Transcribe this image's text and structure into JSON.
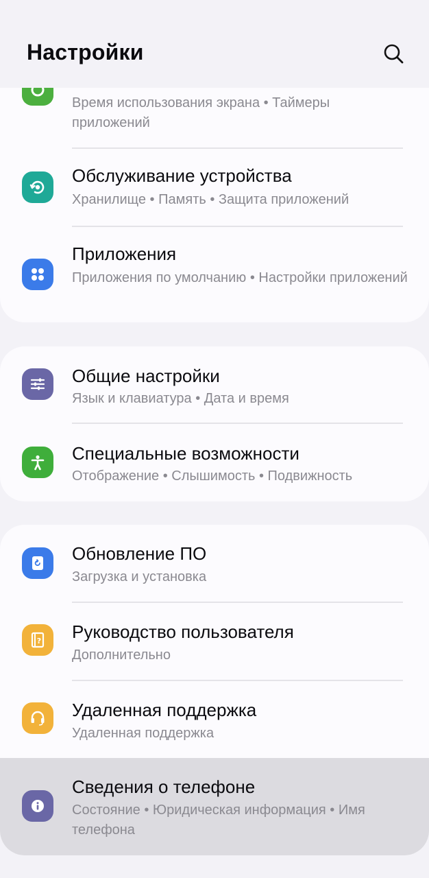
{
  "header": {
    "title": "Настройки",
    "search_icon": "search-icon"
  },
  "groups": [
    {
      "items": [
        {
          "name": "digital-wellbeing",
          "title": "",
          "subtitle": "Время использования экрана  •  Таймеры приложений",
          "icon": "wellbeing-icon",
          "icon_color": "#4caf3f"
        },
        {
          "name": "device-care",
          "title": "Обслуживание устройства",
          "subtitle": "Хранилище  •  Память  •  Защита приложений",
          "icon": "device-care-icon",
          "icon_color": "#1fa997"
        },
        {
          "name": "apps",
          "title": "Приложения",
          "subtitle": "Приложения по умолчанию  •  Настройки приложений",
          "icon": "apps-icon",
          "icon_color": "#3b7be9"
        }
      ]
    },
    {
      "items": [
        {
          "name": "general-management",
          "title": "Общие настройки",
          "subtitle": "Язык и клавиатура  •  Дата и время",
          "icon": "sliders-icon",
          "icon_color": "#6a67a6"
        },
        {
          "name": "accessibility",
          "title": "Специальные возможности",
          "subtitle": "Отображение  •  Слышимость  •  Подвижность",
          "icon": "accessibility-icon",
          "icon_color": "#3fae3b"
        }
      ]
    },
    {
      "items": [
        {
          "name": "software-update",
          "title": "Обновление ПО",
          "subtitle": "Загрузка и установка",
          "icon": "update-icon",
          "icon_color": "#3b7be9"
        },
        {
          "name": "user-manual",
          "title": "Руководство пользователя",
          "subtitle": "Дополнительно",
          "icon": "manual-icon",
          "icon_color": "#f2b23a"
        },
        {
          "name": "remote-support",
          "title": "Удаленная поддержка",
          "subtitle": "Удаленная поддержка",
          "icon": "headset-icon",
          "icon_color": "#f2b23a"
        },
        {
          "name": "about-phone",
          "title": "Сведения о телефоне",
          "subtitle": "Состояние  •  Юридическая информация  •  Имя телефона",
          "icon": "info-icon",
          "icon_color": "#6a67a6"
        }
      ]
    }
  ]
}
